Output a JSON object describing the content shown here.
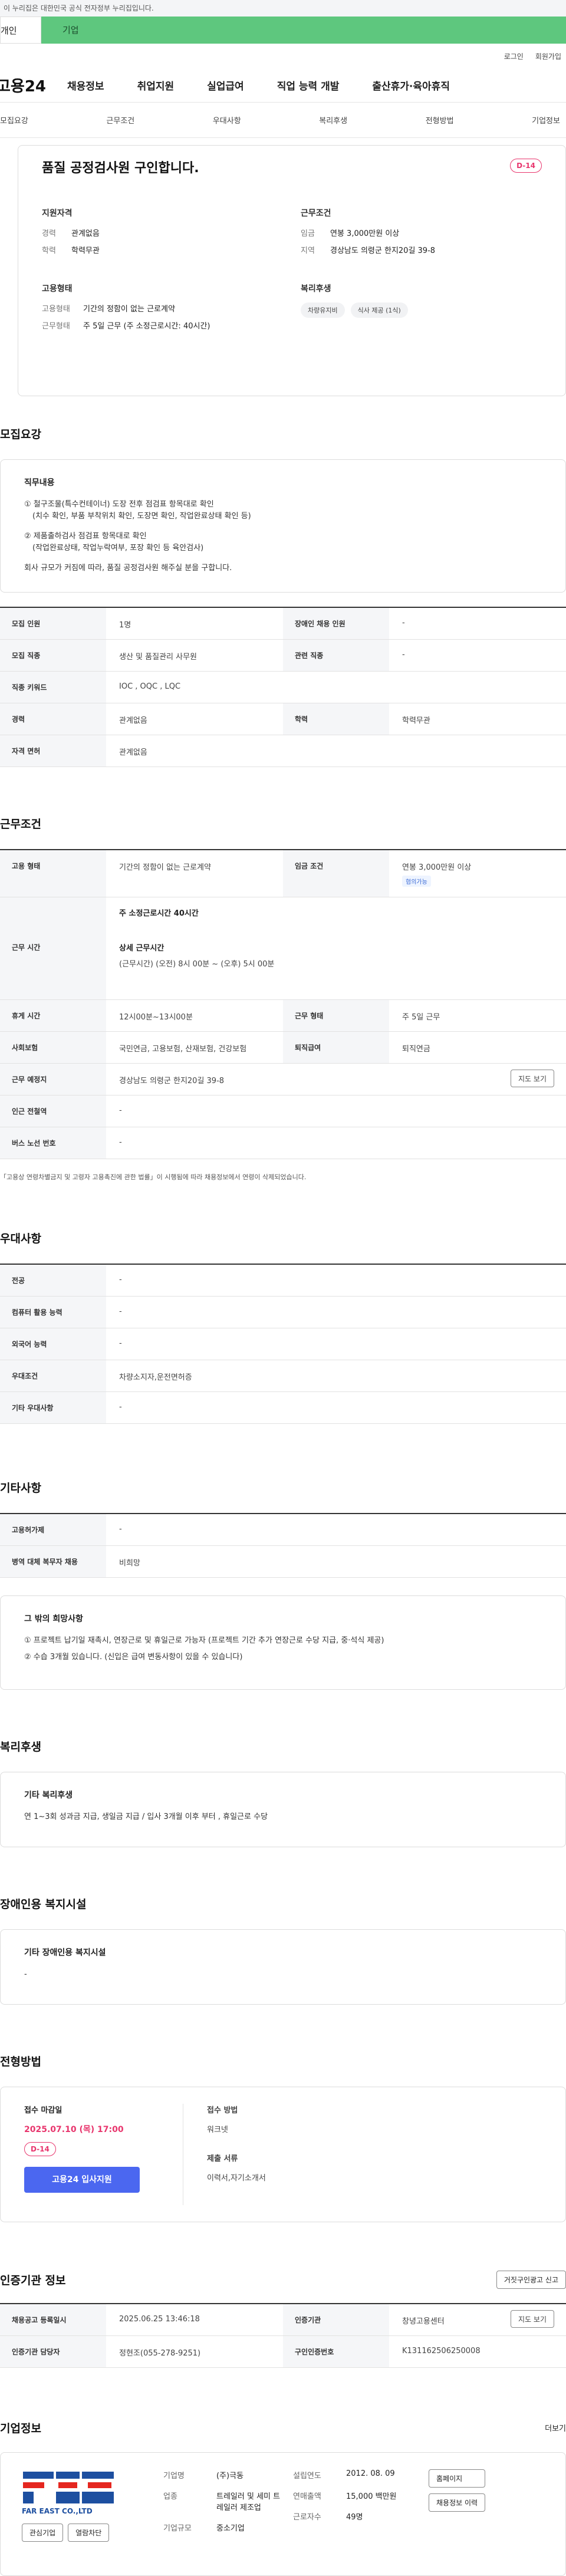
{
  "gov_notice": "이 누리집은 대한민국 공식 전자정부 누리집입니다.",
  "gnb_tabs": {
    "person": "개인",
    "company": "기업"
  },
  "util_links": {
    "login": "로그인",
    "join": "회원가입"
  },
  "logo_text": "고용24",
  "main_nav": [
    "채용정보",
    "취업지원",
    "실업급여",
    "직업 능력 개발",
    "출산휴가·육아휴직"
  ],
  "anchors": [
    "모집요강",
    "근무조건",
    "우대사항",
    "복리후생",
    "전형방법",
    "기업정보"
  ],
  "summary": {
    "title": "품질 공정검사원 구인합니다.",
    "dday": "D-14",
    "qualification": {
      "heading": "지원자격",
      "career_k": "경력",
      "career_v": "관계없음",
      "edu_k": "학력",
      "edu_v": "학력무관"
    },
    "condition": {
      "heading": "근무조건",
      "wage_k": "임금",
      "wage_v": "연봉 3,000만원 이상",
      "region_k": "지역",
      "region_v": "경상남도 의령군 한지20길 39-8"
    },
    "employment": {
      "heading": "고용형태",
      "type_k": "고용형태",
      "type_v": "기간의 정함이 없는 근로계약",
      "work_k": "근무형태",
      "work_v": "주 5일 근무 (주 소정근로시간: 40시간)"
    },
    "welfare": {
      "heading": "복리후생",
      "chip1": "차량유지비",
      "chip2": "식사 제공 (1식)"
    }
  },
  "recruit": {
    "section_title": "모집요강",
    "duty_heading": "직무내용",
    "duty_lines": [
      "① 철구조물(특수컨테이너) 도장 전후 점검표 항목대로 확인",
      "   (치수 확인, 부품 부착위치 확인, 도장면 확인, 작업완료상태 확인 등)",
      "② 제품출하검사 점검표 항목대로 확인",
      "   (작업완료상태, 작업누락여부, 포장 확인 등 육안검사)",
      "회사 규모가 커짐에 따라, 품질 공정검사원 해주실 분을 구합니다."
    ],
    "rows": {
      "headcount_k": "모집 인원",
      "headcount_v": "1명",
      "disabled_k": "장애인 채용 인원",
      "disabled_v": "-",
      "job_k": "모집 직종",
      "job_v": "생산 및 품질관리 사무원",
      "related_k": "관련 직종",
      "related_v": "-",
      "keyword_k": "직종 키워드",
      "keyword_v": "IOC , OQC , LQC",
      "career_k": "경력",
      "career_v": "관계없음",
      "edu_k": "학력",
      "edu_v": "학력무관",
      "license_k": "자격 면허",
      "license_v": "관계없음"
    }
  },
  "conditions": {
    "section_title": "근무조건",
    "type_k": "고용 형태",
    "type_v": "기간의 정함이 없는 근로계약",
    "wage_k": "임금 조건",
    "wage_v": "연봉 3,000만원 이상",
    "wage_tag": "협의가능",
    "hours_k": "근무 시간",
    "hours_main": "주 소정근로시간 40시간",
    "hours_detail_h": "상세 근무시간",
    "hours_detail_v": "(근무시간) (오전) 8시 00분 ~ (오후) 5시 00분",
    "break_k": "휴게 시간",
    "break_v": "12시00분~13시00분",
    "shift_k": "근무 형태",
    "shift_v": "주 5일 근무",
    "insurance_k": "사회보험",
    "insurance_v": "국민연금, 고용보험, 산재보험, 건강보험",
    "retire_k": "퇴직급여",
    "retire_v": "퇴직연금",
    "place_k": "근무 예정지",
    "place_v": "경상남도 의령군 한지20길 39-8",
    "map_btn": "지도 보기",
    "subway_k": "인근 전철역",
    "subway_v": "-",
    "bus_k": "버스 노선 번호",
    "bus_v": "-",
    "footnote": "「고용상 연령차별금지 및 고령자 고용촉진에 관한 법률」이 시행됨에 따라 채용정보에서 연령이 삭제되었습니다."
  },
  "preference": {
    "section_title": "우대사항",
    "major_k": "전공",
    "major_v": "-",
    "computer_k": "컴퓨터 활용 능력",
    "computer_v": "-",
    "lang_k": "외국어 능력",
    "lang_v": "-",
    "pref_k": "우대조건",
    "pref_v": "차량소지자,운전면허증",
    "etc_k": "기타 우대사항",
    "etc_v": "-"
  },
  "other": {
    "section_title": "기타사항",
    "employ_k": "고용허가제",
    "employ_v": "-",
    "military_k": "병역 대체 복무자 채용",
    "military_v": "비희망",
    "wish_heading": "그 밖의 희망사항",
    "wish_lines": [
      "① 프로젝트 납기일 재촉시, 연장근로 및 휴일근로 가능자 (프로젝트 기간 추가 연장근로 수당 지급, 중·석식 제공)",
      "② 수습 3개월 있습니다. (신입은 급여 변동사항이 있을 수 있습니다)"
    ]
  },
  "welfare_section": {
    "section_title": "복리후생",
    "heading": "기타 복리후생",
    "text": "연 1~3회 성과금 지급, 생일금 지급 / 입사 3개월 이후 부터 , 휴일근로 수당"
  },
  "disability": {
    "section_title": "장애인용 복지시설",
    "heading": "기타 장애인용 복지시설",
    "text": "-"
  },
  "process": {
    "section_title": "전형방법",
    "deadline_h": "접수 마감일",
    "deadline_v": "2025.07.10 (목) 17:00",
    "dday": "D-14",
    "apply_btn": "고용24 입사지원",
    "method_h": "접수 방법",
    "method_v": "워크넷",
    "docs_h": "제출 서류",
    "docs_v": "이력서,자기소개서"
  },
  "certify": {
    "section_title": "인증기관 정보",
    "report_btn": "거짓구인광고 신고",
    "date_k": "채용공고 등록일시",
    "date_v": "2025.06.25 13:46:18",
    "org_k": "인증기관",
    "org_v": "창녕고용센터",
    "map_btn": "지도 보기",
    "manager_k": "인증기관 담당자",
    "manager_v": "정현조(055-278-9251)",
    "id_k": "구인인증번호",
    "id_v": "K131162506250008"
  },
  "company": {
    "section_title": "기업정보",
    "more": "더보기",
    "logo_caption": "FAR EAST CO.,LTD",
    "interest_btn": "관심기업",
    "block_btn": "열람차단",
    "name_k": "기업명",
    "name_v": "(주)극동",
    "industry_k": "업종",
    "industry_v": "트레일러 및 세미 트레일러 제조업",
    "size_k": "기업규모",
    "size_v": "중소기업",
    "founded_k": "설립연도",
    "founded_v": "2012. 08. 09",
    "sales_k": "연매출액",
    "sales_v": "15,000 백만원",
    "staff_k": "근로자수",
    "staff_v": "49명",
    "home_btn": "홈페이지",
    "history_btn": "채용정보 이력"
  },
  "colors": {
    "accent": "#5ec77e",
    "dday": "#e8356d",
    "apply": "#4b67f0"
  }
}
